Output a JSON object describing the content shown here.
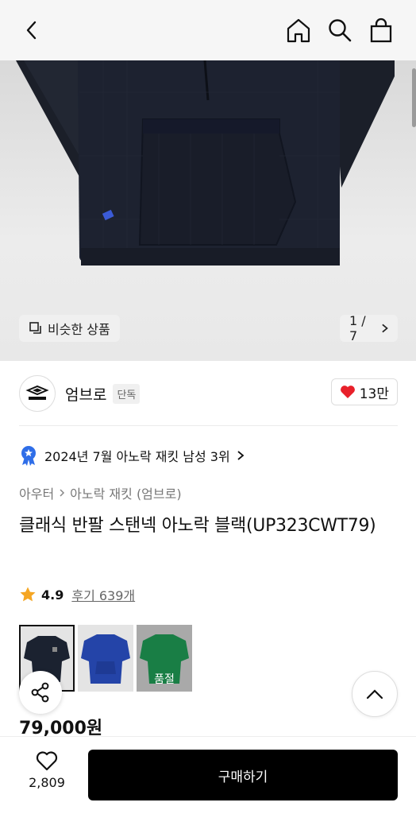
{
  "header": {
    "back_icon": "chevron-left-icon",
    "home_icon": "home-icon",
    "search_icon": "search-icon",
    "bag_icon": "shopping-bag-icon",
    "bg_color": "#f6f6f6"
  },
  "gallery": {
    "similar_label": "비슷한 상품",
    "pager_text": "1 / 7",
    "current_page": 1,
    "total_pages": 7
  },
  "brand": {
    "name": "엄브로",
    "tag": "단독",
    "likes": "13만"
  },
  "ranking": {
    "text": "2024년 7월 아노락 재킷 남성 3위"
  },
  "breadcrumb": {
    "category": "아우터",
    "subcategory": "아노락 재킷 (엄브로)"
  },
  "product": {
    "title": "클래식 반팔 스탠넥 아노락 블랙(UP323CWT79)",
    "rating": "4.9",
    "reviews": "후기 639개",
    "price": "79,000원"
  },
  "swatches": [
    {
      "color": "블랙",
      "hex": "#1b2230",
      "selected": true,
      "sold_out": false
    },
    {
      "color": "블루",
      "hex": "#2444a8",
      "selected": false,
      "sold_out": false
    },
    {
      "color": "그린",
      "hex": "#1f9a55",
      "selected": false,
      "sold_out": true,
      "sold_label": "품절"
    }
  ],
  "bottom_bar": {
    "wish_count": "2,809",
    "buy_label": "구매하기"
  },
  "colors": {
    "accent_heart": "#e8202a",
    "rank_badge": "#2f6ee8",
    "star": "#f5a623",
    "buy_button": "#000000"
  }
}
